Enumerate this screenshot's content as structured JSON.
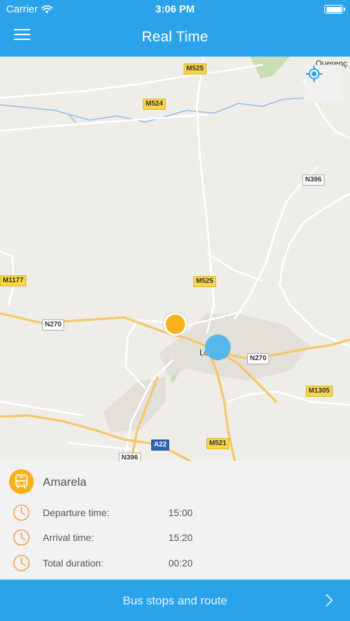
{
  "status_bar": {
    "carrier": "Carrier",
    "time": "3:06 PM",
    "icons": [
      "wifi-icon",
      "battery-icon"
    ]
  },
  "nav": {
    "title": "Real Time",
    "menu_icon": "hamburger-menu-icon"
  },
  "map": {
    "road_labels": {
      "m525_top": "M525",
      "m524": "M524",
      "n396_right": "N396",
      "m1177": "M1177",
      "m525_mid": "M525",
      "n270_left": "N270",
      "n270_right": "N270",
      "m1305": "M1305",
      "a22": "A22",
      "m521": "M521",
      "n396_bottom": "N396"
    },
    "places": {
      "querenca": "Querenç",
      "loule": "Lou"
    },
    "locate_icon": "crosshair-location-icon",
    "colors": {
      "land": "#efede8",
      "road_major": "#f5c766",
      "road_minor": "#ffffff",
      "water": "#7fb6e6",
      "park": "#c7e0b4"
    }
  },
  "trip": {
    "bus_icon": "bus-icon",
    "bus_name": "Amarela",
    "rows": [
      {
        "label": "Departure time:",
        "value": "15:00"
      },
      {
        "label": "Arrival time:",
        "value": "15:20"
      },
      {
        "label": "Total duration:",
        "value": "00:20"
      }
    ]
  },
  "footer": {
    "button_label": "Bus stops and route",
    "chevron_icon": "chevron-right-icon"
  },
  "theme": {
    "primary": "#2aa3ea",
    "accent": "#f9b21c",
    "clock_color": "#f0a04b"
  }
}
